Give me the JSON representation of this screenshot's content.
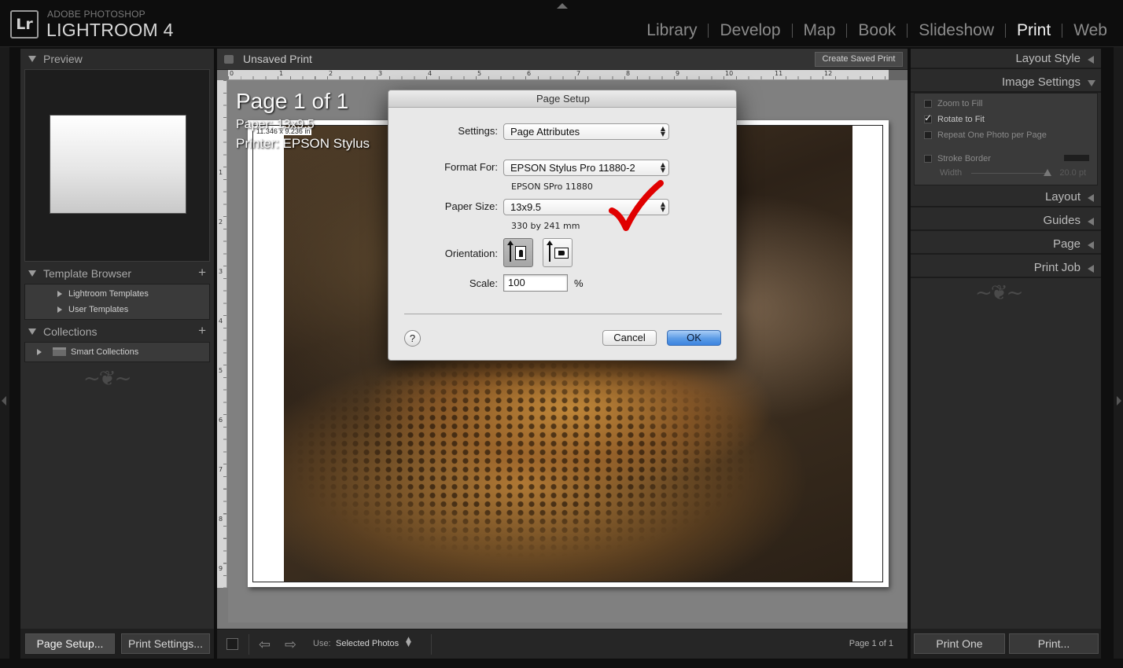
{
  "app": {
    "brand_small": "ADOBE PHOTOSHOP",
    "brand_big": "LIGHTROOM 4",
    "logo": "Lr"
  },
  "modules": [
    "Library",
    "Develop",
    "Map",
    "Book",
    "Slideshow",
    "Print",
    "Web"
  ],
  "active_module": "Print",
  "left_panel": {
    "preview_title": "Preview",
    "template_browser": {
      "title": "Template Browser",
      "items": [
        "Lightroom Templates",
        "User Templates"
      ]
    },
    "collections": {
      "title": "Collections",
      "items": [
        "Smart Collections"
      ]
    }
  },
  "left_buttons": {
    "page_setup": "Page Setup...",
    "print_settings": "Print Settings..."
  },
  "center": {
    "title": "Unsaved Print",
    "create_saved_print": "Create Saved Print",
    "page_info": {
      "page": "Page 1 of 1",
      "paper": "Paper:  13x9.5",
      "printer": "Printer:  EPSON Stylus"
    },
    "cell_dimensions": "11.346 x 9.236 in",
    "ruler_top": [
      "0",
      "1",
      "2",
      "3",
      "4",
      "5",
      "6",
      "7",
      "8",
      "9",
      "10",
      "11",
      "12"
    ],
    "ruler_left": [
      "1",
      "2",
      "3",
      "4",
      "5",
      "6",
      "7",
      "8",
      "9"
    ],
    "photo_subject": "leopard"
  },
  "bottom_toolbar": {
    "use_label": "Use:",
    "use_value": "Selected Photos",
    "page_count": "Page 1 of 1"
  },
  "right_panel": {
    "sections": [
      "Layout Style",
      "Image Settings",
      "Layout",
      "Guides",
      "Page",
      "Print Job"
    ],
    "image_settings": {
      "zoom_to_fill": {
        "label": "Zoom to Fill",
        "checked": false
      },
      "rotate_to_fit": {
        "label": "Rotate to Fit",
        "checked": true
      },
      "repeat_one_photo": {
        "label": "Repeat One Photo per Page",
        "checked": false
      },
      "stroke_border": {
        "label": "Stroke Border",
        "checked": false
      },
      "width_label": "Width",
      "width_value": "20.0 pt"
    }
  },
  "right_buttons": {
    "print_one": "Print One",
    "print": "Print..."
  },
  "dialog": {
    "title": "Page Setup",
    "settings_label": "Settings:",
    "settings_value": "Page Attributes",
    "format_for_label": "Format For:",
    "format_for_value": "EPSON Stylus Pro 11880-2",
    "format_for_sub": "EPSON SPro 11880",
    "paper_size_label": "Paper Size:",
    "paper_size_value": "13x9.5",
    "paper_size_sub": "330 by 241 mm",
    "orientation_label": "Orientation:",
    "orientation_selected": "portrait",
    "scale_label": "Scale:",
    "scale_value": "100",
    "scale_unit": "%",
    "help": "?",
    "cancel": "Cancel",
    "ok": "OK"
  },
  "colors": {
    "background": "#0f0f0f",
    "panel": "#2b2b2b",
    "dialog": "#e8e8e8",
    "ok_button": "#5b9be6",
    "annotation_check": "#e00000"
  }
}
